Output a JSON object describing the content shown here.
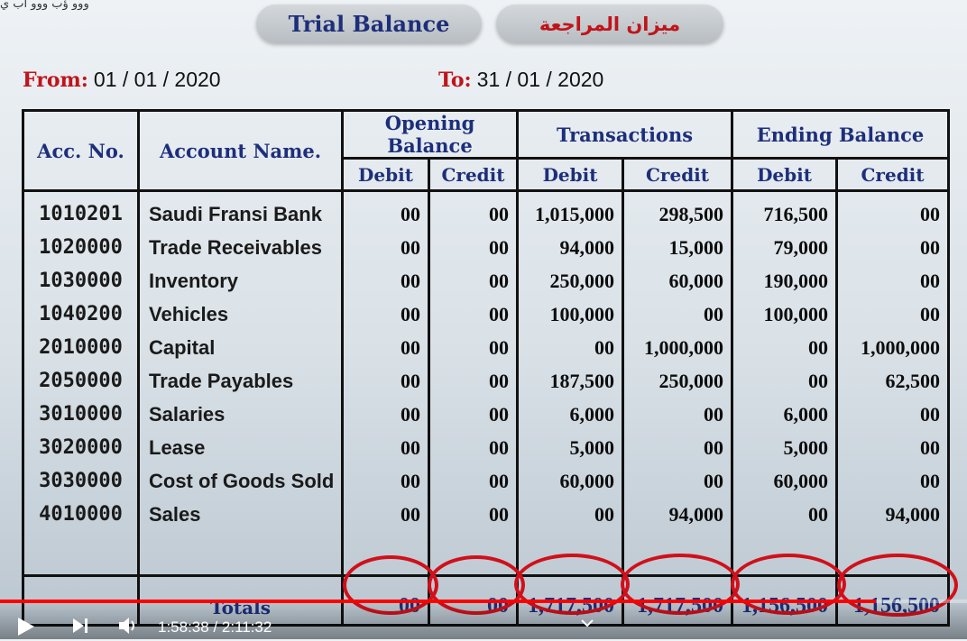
{
  "header": {
    "top_strip_text": "ووو ؤب ووو اب ي",
    "title_en": "Trial Balance",
    "title_ar": "ميزان المراجعة"
  },
  "period": {
    "from_label": "From:",
    "from_value": "01 / 01 / 2020",
    "to_label": "To:",
    "to_value": "31 / 01 / 2020"
  },
  "table": {
    "col_acc": "Acc. No.",
    "col_name": "Account Name.",
    "group_opening": "Opening Balance",
    "group_transactions": "Transactions",
    "group_ending": "Ending Balance",
    "debit": "Debit",
    "credit": "Credit",
    "rows": [
      {
        "acc": "1010201",
        "name": "Saudi Fransi Bank",
        "od": "00",
        "oc": "00",
        "td": "1,015,000",
        "tc": "298,500",
        "ed": "716,500",
        "ec": "00"
      },
      {
        "acc": "1020000",
        "name": "Trade Receivables",
        "od": "00",
        "oc": "00",
        "td": "94,000",
        "tc": "15,000",
        "ed": "79,000",
        "ec": "00"
      },
      {
        "acc": "1030000",
        "name": "Inventory",
        "od": "00",
        "oc": "00",
        "td": "250,000",
        "tc": "60,000",
        "ed": "190,000",
        "ec": "00"
      },
      {
        "acc": "1040200",
        "name": "Vehicles",
        "od": "00",
        "oc": "00",
        "td": "100,000",
        "tc": "00",
        "ed": "100,000",
        "ec": "00"
      },
      {
        "acc": "2010000",
        "name": "Capital",
        "od": "00",
        "oc": "00",
        "td": "00",
        "tc": "1,000,000",
        "ed": "00",
        "ec": "1,000,000"
      },
      {
        "acc": "2050000",
        "name": "Trade Payables",
        "od": "00",
        "oc": "00",
        "td": "187,500",
        "tc": "250,000",
        "ed": "00",
        "ec": "62,500"
      },
      {
        "acc": "3010000",
        "name": "Salaries",
        "od": "00",
        "oc": "00",
        "td": "6,000",
        "tc": "00",
        "ed": "6,000",
        "ec": "00"
      },
      {
        "acc": "3020000",
        "name": "Lease",
        "od": "00",
        "oc": "00",
        "td": "5,000",
        "tc": "00",
        "ed": "5,000",
        "ec": "00"
      },
      {
        "acc": "3030000",
        "name": "Cost of Goods Sold",
        "od": "00",
        "oc": "00",
        "td": "60,000",
        "tc": "00",
        "ed": "60,000",
        "ec": "00"
      },
      {
        "acc": "4010000",
        "name": "Sales",
        "od": "00",
        "oc": "00",
        "td": "00",
        "tc": "94,000",
        "ed": "00",
        "ec": "94,000"
      }
    ],
    "totals": {
      "label": "Totals",
      "od": "00",
      "oc": "00",
      "td": "1,717,500",
      "tc": "1,717,500",
      "ed": "1,156,500",
      "ec": "1,156,500"
    }
  },
  "player": {
    "time": "1:58:38 / 2:11:32",
    "progress_fraction": 0.906,
    "play_icon": "play-icon",
    "next_icon": "next-icon",
    "volume_icon": "volume-icon",
    "chevron_icon": "chevron-down-icon",
    "accent_color": "#ff0000"
  }
}
